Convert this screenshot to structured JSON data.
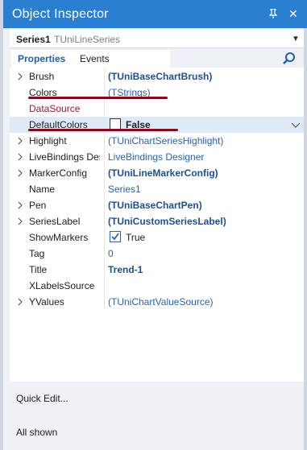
{
  "window": {
    "title": "Object Inspector",
    "pin_icon": "pin-icon",
    "close_icon": "close-icon"
  },
  "object_selector": {
    "name": "Series1",
    "type": "TUniLineSeries"
  },
  "tabs": [
    {
      "label": "Properties",
      "active": true
    },
    {
      "label": "Events",
      "active": false
    }
  ],
  "properties": [
    {
      "name": "Brush",
      "value": "(TUniBaseChartBrush)",
      "expandable": true
    },
    {
      "name": "Colors",
      "value": "(TStrings)",
      "expandable": false
    },
    {
      "name": "DataSource",
      "value": "",
      "expandable": false
    },
    {
      "name": "DefaultColors",
      "value": "False",
      "checked": false,
      "expandable": false
    },
    {
      "name": "Highlight",
      "value": "(TUniChartSeriesHighlight)",
      "expandable": true
    },
    {
      "name": "LiveBindings Des",
      "value": "LiveBindings Designer",
      "expandable": true
    },
    {
      "name": "MarkerConfig",
      "value": "(TUniLineMarkerConfig)",
      "expandable": true
    },
    {
      "name": "Name",
      "value": "Series1",
      "expandable": false
    },
    {
      "name": "Pen",
      "value": "(TUniBaseChartPen)",
      "expandable": true
    },
    {
      "name": "SeriesLabel",
      "value": "(TUniCustomSeriesLabel)",
      "expandable": true
    },
    {
      "name": "ShowMarkers",
      "value": "True",
      "checked": true,
      "expandable": false
    },
    {
      "name": "Tag",
      "value": "0",
      "expandable": false
    },
    {
      "name": "Title",
      "value": "Trend-1",
      "expandable": false
    },
    {
      "name": "XLabelsSource",
      "value": "",
      "expandable": false
    },
    {
      "name": "YValues",
      "value": "(TUniChartValueSource)",
      "expandable": true
    }
  ],
  "footer": {
    "quick_edit": "Quick Edit...",
    "status": "All shown"
  },
  "colors": {
    "titlebar": "#2a7fd0",
    "accent": "#1f5fa8",
    "annotation": "#7a0f20",
    "selected_row": "#dfeaf7"
  }
}
